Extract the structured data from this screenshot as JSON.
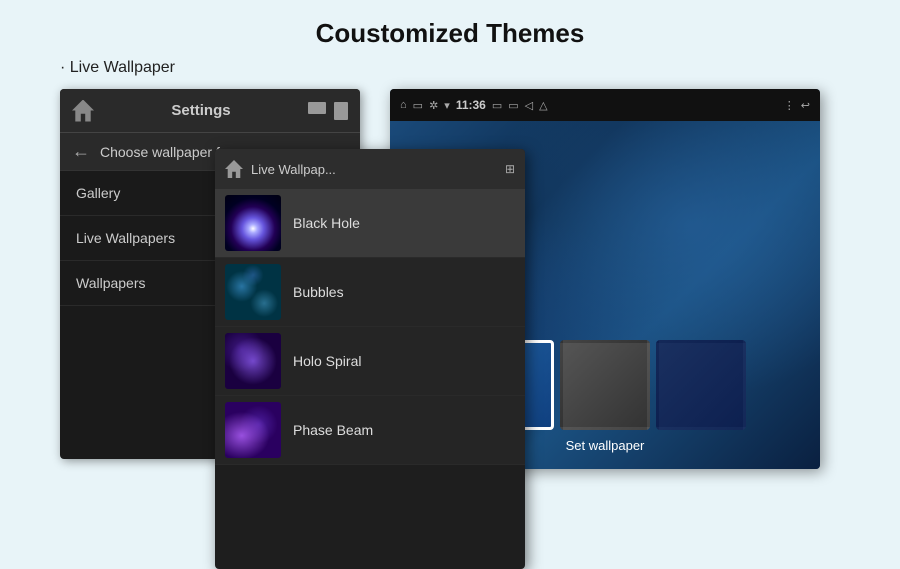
{
  "page": {
    "title": "Coustomized Themes",
    "subtitle": "· Live Wallpaper"
  },
  "settings_screen": {
    "topbar": {
      "title": "Settings"
    },
    "backbar": {
      "label": "Choose wallpaper from"
    },
    "menu_items": [
      {
        "label": "Gallery"
      },
      {
        "label": "Live Wallpapers"
      },
      {
        "label": "Wallpapers"
      }
    ]
  },
  "live_wallpapers": {
    "topbar_title": "Live Wallpap...",
    "items": [
      {
        "label": "Black Hole",
        "thumb": "black-hole"
      },
      {
        "label": "Bubbles",
        "thumb": "bubbles"
      },
      {
        "label": "Holo Spiral",
        "thumb": "holo-spiral"
      },
      {
        "label": "Phase Beam",
        "thumb": "phase-beam"
      }
    ]
  },
  "preview": {
    "time": "11:36",
    "set_wallpaper_label": "Set wallpaper"
  }
}
